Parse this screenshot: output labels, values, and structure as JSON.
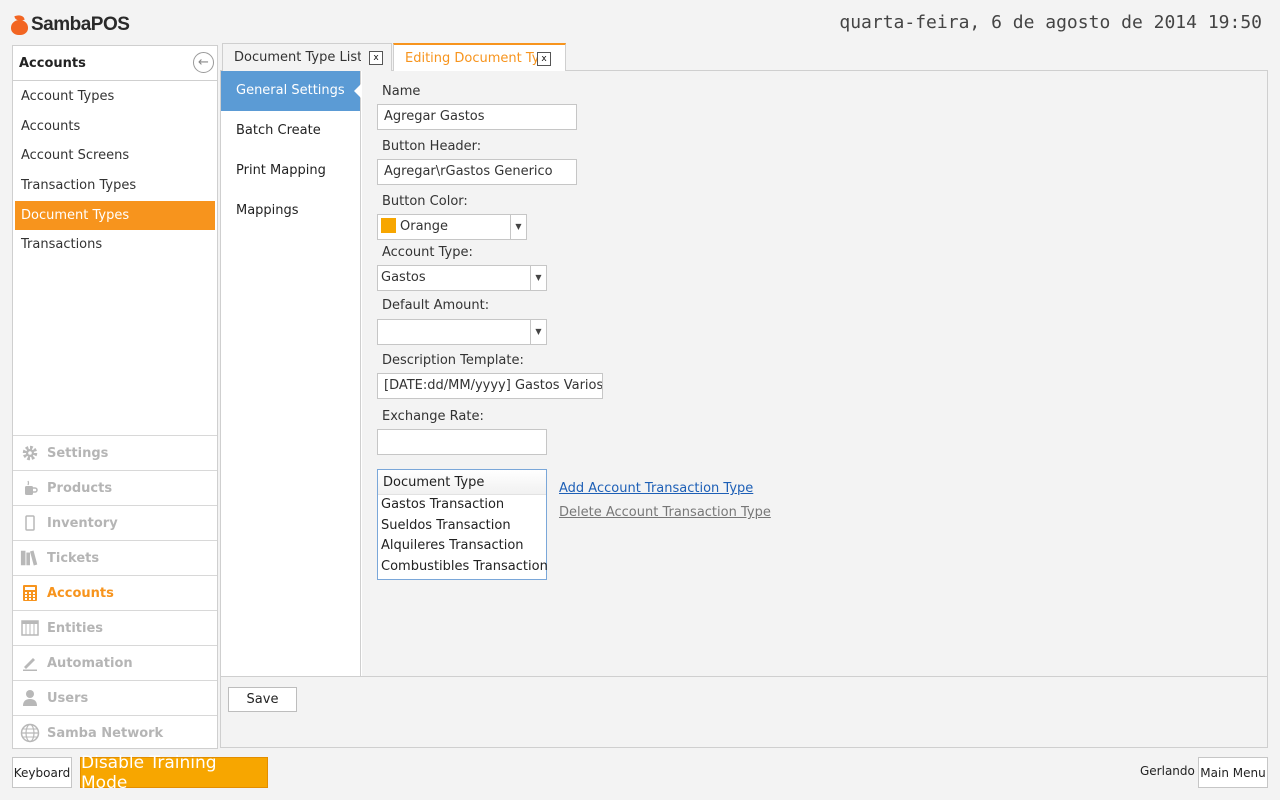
{
  "header": {
    "logo_text": "SambaPOS",
    "datetime": "quarta-feira, 6 de agosto de 2014 19:50"
  },
  "left_panel": {
    "title": "Accounts",
    "sub_items": [
      {
        "label": "Account Types",
        "active": false
      },
      {
        "label": "Accounts",
        "active": false
      },
      {
        "label": "Account Screens",
        "active": false
      },
      {
        "label": "Transaction Types",
        "active": false
      },
      {
        "label": "Document Types",
        "active": true
      },
      {
        "label": "Transactions",
        "active": false
      }
    ],
    "nav_items": [
      {
        "label": "Settings",
        "icon": "gear-icon",
        "active": false
      },
      {
        "label": "Products",
        "icon": "coffee-cup-icon",
        "active": false
      },
      {
        "label": "Inventory",
        "icon": "phone-icon",
        "active": false
      },
      {
        "label": "Tickets",
        "icon": "books-icon",
        "active": false
      },
      {
        "label": "Accounts",
        "icon": "calculator-icon",
        "active": true
      },
      {
        "label": "Entities",
        "icon": "grid-icon",
        "active": false
      },
      {
        "label": "Automation",
        "icon": "pencil-icon",
        "active": false
      },
      {
        "label": "Users",
        "icon": "user-icon",
        "active": false
      },
      {
        "label": "Samba Network",
        "icon": "globe-icon",
        "active": false
      }
    ]
  },
  "tabs": [
    {
      "label": "Document Type List",
      "close": "x",
      "active": false
    },
    {
      "label": "Editing Document Type",
      "close": "x",
      "active": true
    }
  ],
  "settings_nav": [
    {
      "label": "General Settings",
      "active": true
    },
    {
      "label": "Batch Create",
      "active": false
    },
    {
      "label": "Print Mapping",
      "active": false
    },
    {
      "label": "Mappings",
      "active": false
    }
  ],
  "form": {
    "name_label": "Name",
    "name_value": "Agregar Gastos",
    "button_header_label": "Button Header:",
    "button_header_value": "Agregar\\rGastos Generico",
    "button_color_label": "Button Color:",
    "button_color_value": "Orange",
    "button_color_hex": "#f7a600",
    "account_type_label": "Account Type:",
    "account_type_value": "Gastos",
    "default_amount_label": "Default Amount:",
    "default_amount_value": "",
    "description_template_label": "Description Template:",
    "description_template_value": "[DATE:dd/MM/yyyy] Gastos Varios",
    "exchange_rate_label": "Exchange Rate:",
    "exchange_rate_value": ""
  },
  "transaction_list": {
    "header": "Document Type",
    "items": [
      "Gastos Transaction",
      "Sueldos Transaction",
      "Alquileres Transaction",
      "Combustibles Transaction"
    ],
    "add_link": "Add Account Transaction Type",
    "delete_link": "Delete Account Transaction Type"
  },
  "footer": {
    "save_label": "Save",
    "keyboard_label": "Keyboard",
    "training_label": "Disable Training Mode",
    "user_name": "Gerlando",
    "main_menu_label": "Main Menu"
  },
  "colors": {
    "accent": "#f7941d",
    "active_nav": "#5b9bd5",
    "link": "#1d5fb6"
  }
}
